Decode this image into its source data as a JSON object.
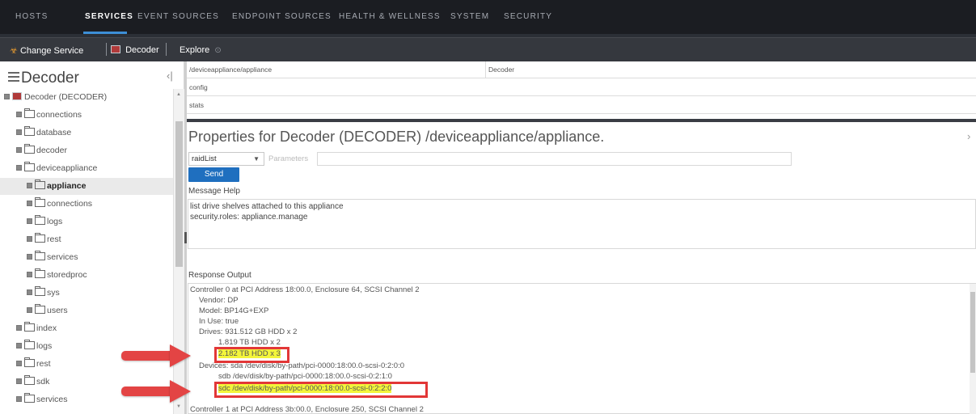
{
  "topnav": {
    "tabs": [
      "HOSTS",
      "SERVICES",
      "EVENT SOURCES",
      "ENDPOINT SOURCES",
      "HEALTH & WELLNESS",
      "SYSTEM",
      "SECURITY"
    ],
    "active_tab": "SERVICES"
  },
  "toolbar": {
    "change_service": "Change Service",
    "service": "Decoder",
    "explore": "Explore"
  },
  "tree": {
    "title": "Decoder",
    "root": "Decoder (DECODER)",
    "items": [
      "connections",
      "database",
      "decoder",
      "deviceappliance",
      "appliance",
      "connections",
      "logs",
      "rest",
      "services",
      "storedproc",
      "sys",
      "users",
      "index",
      "logs",
      "rest",
      "sdk",
      "services"
    ],
    "selected": "appliance"
  },
  "nodes_table": {
    "rows": [
      {
        "path": "/deviceappliance/appliance",
        "type": "Decoder"
      },
      {
        "path": "config",
        "type": ""
      },
      {
        "path": "stats",
        "type": ""
      }
    ]
  },
  "properties": {
    "title": "Properties for Decoder (DECODER) /deviceappliance/appliance.",
    "message_select": "raidList",
    "parameters_placeholder": "Parameters",
    "send_label": "Send",
    "message_help_label": "Message Help",
    "message_help_lines": [
      "list drive shelves attached to this appliance",
      "security.roles: appliance.manage"
    ],
    "response_label": "Response Output",
    "response_lines": [
      "Controller 0 at PCI Address 18:00.0, Enclosure 64, SCSI Channel 2",
      "Vendor:  DP",
      "Model:  BP14G+EXP",
      "In Use:  true",
      "Drives:  931.512 GB HDD x 2",
      "1.819 TB HDD x 2",
      "2.182 TB HDD x 3",
      "Devices: sda /dev/disk/by-path/pci-0000:18:00.0-scsi-0:2:0:0",
      "sdb /dev/disk/by-path/pci-0000:18:00.0-scsi-0:2:1:0",
      "sdc /dev/disk/by-path/pci-0000:18:00.0-scsi-0:2:2:0",
      "Controller 1 at PCI Address 3b:00.0, Enclosure 250, SCSI Channel 2"
    ]
  },
  "colors": {
    "highlight": "#f3f53a",
    "annotation": "#e23737",
    "accent": "#1f6fbf"
  }
}
